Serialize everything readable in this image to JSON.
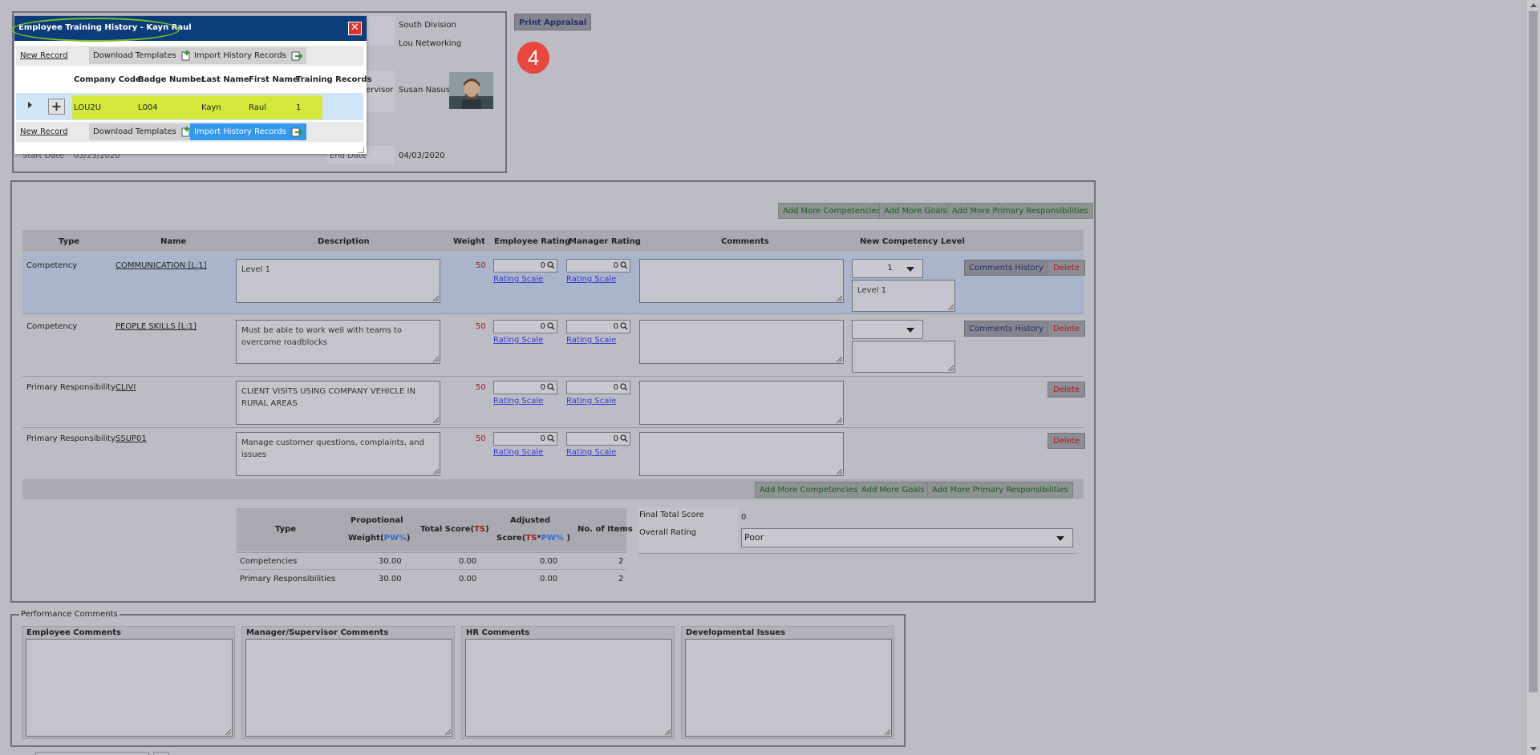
{
  "header": {
    "division": "South Division",
    "department": "Lou Networking",
    "supervisor_label_partial": "ervisor",
    "supervisor_name": "Susan Nasus",
    "start_date_label": "Start Date",
    "start_date_value": "03/25/2020",
    "end_date_label": "End Date",
    "end_date_value": "04/03/2020",
    "print_button": "Print Appraisal",
    "step_badge": "4"
  },
  "modal": {
    "title": "Employee Training History - Kayn Raul",
    "new_record": "New Record",
    "download_templates": "Download Templates",
    "import_history": "Import History Records",
    "columns": [
      "Company Code",
      "Badge Number",
      "Last Name",
      "First Name",
      "Training Records"
    ],
    "row": {
      "company_code": "LOU2U",
      "badge_number": "L004",
      "last_name": "Kayn",
      "first_name": "Raul",
      "training_records": "1"
    }
  },
  "toolbar": {
    "add_competencies": "Add More Competencies",
    "add_goals": "Add More Goals",
    "add_primary": "Add More Primary Responsibilities"
  },
  "grid": {
    "columns": [
      "Type",
      "Name",
      "Description",
      "Weight",
      "Employee Rating",
      "Manager Rating",
      "Comments",
      "New Competency Level"
    ],
    "rating_scale": "Rating Scale",
    "comments_history": "Comments History",
    "delete": "Delete",
    "rows": [
      {
        "type": "Competency",
        "name": "COMMUNICATION [L:1]",
        "description": "Level 1",
        "weight": "50",
        "emp_rating": "0",
        "mgr_rating": "0",
        "level": "1",
        "level_desc": "Level 1"
      },
      {
        "type": "Competency",
        "name": "PEOPLE SKILLS [L:1]",
        "description": "Must be able to work well with teams to overcome roadblocks",
        "weight": "50",
        "emp_rating": "0",
        "mgr_rating": "0",
        "level": "",
        "level_desc": ""
      },
      {
        "type": "Primary Responsibility",
        "name": "CLIVI",
        "description": "CLIENT VISITS USING COMPANY VEHICLE IN RURAL AREAS",
        "weight": "50",
        "emp_rating": "0",
        "mgr_rating": "0"
      },
      {
        "type": "Primary Responsibility",
        "name": "SSUP01",
        "description": "Manage customer questions, complaints, and issues",
        "weight": "50",
        "emp_rating": "0",
        "mgr_rating": "0"
      }
    ]
  },
  "summary": {
    "col_type": "Type",
    "col_weight_1": "Propotional",
    "col_weight_2": "Weight(",
    "col_weight_pw": "PW%",
    "col_weight_end": ")",
    "col_total_1": "Total Score(",
    "col_total_ts": "TS",
    "col_total_end": ")",
    "col_adj_1": "Adjusted",
    "col_adj_2": "Score(",
    "col_adj_ts": "TS",
    "col_adj_star": "*",
    "col_adj_pw": "PW%",
    "col_adj_end": " )",
    "col_items": "No. of Items",
    "rows": [
      {
        "type": "Competencies",
        "weight": "30.00",
        "total": "0.00",
        "adjusted": "0.00",
        "items": "2"
      },
      {
        "type": "Primary Responsibilities",
        "weight": "30.00",
        "total": "0.00",
        "adjusted": "0.00",
        "items": "2"
      }
    ],
    "final_total_label": "Final Total Score",
    "final_total_value": "0",
    "overall_rating_label": "Overall Rating",
    "overall_rating_value": "Poor"
  },
  "comments": {
    "legend": "Performance Comments",
    "employee": "Employee Comments",
    "manager": "Manager/Supervisor Comments",
    "hr": "HR Comments",
    "dev": "Developmental Issues"
  },
  "colors": {
    "accent_green": "#d4e83a",
    "modal_title": "#0b3d7a",
    "badge_red": "#e8463e",
    "import_blue": "#3399ee"
  }
}
